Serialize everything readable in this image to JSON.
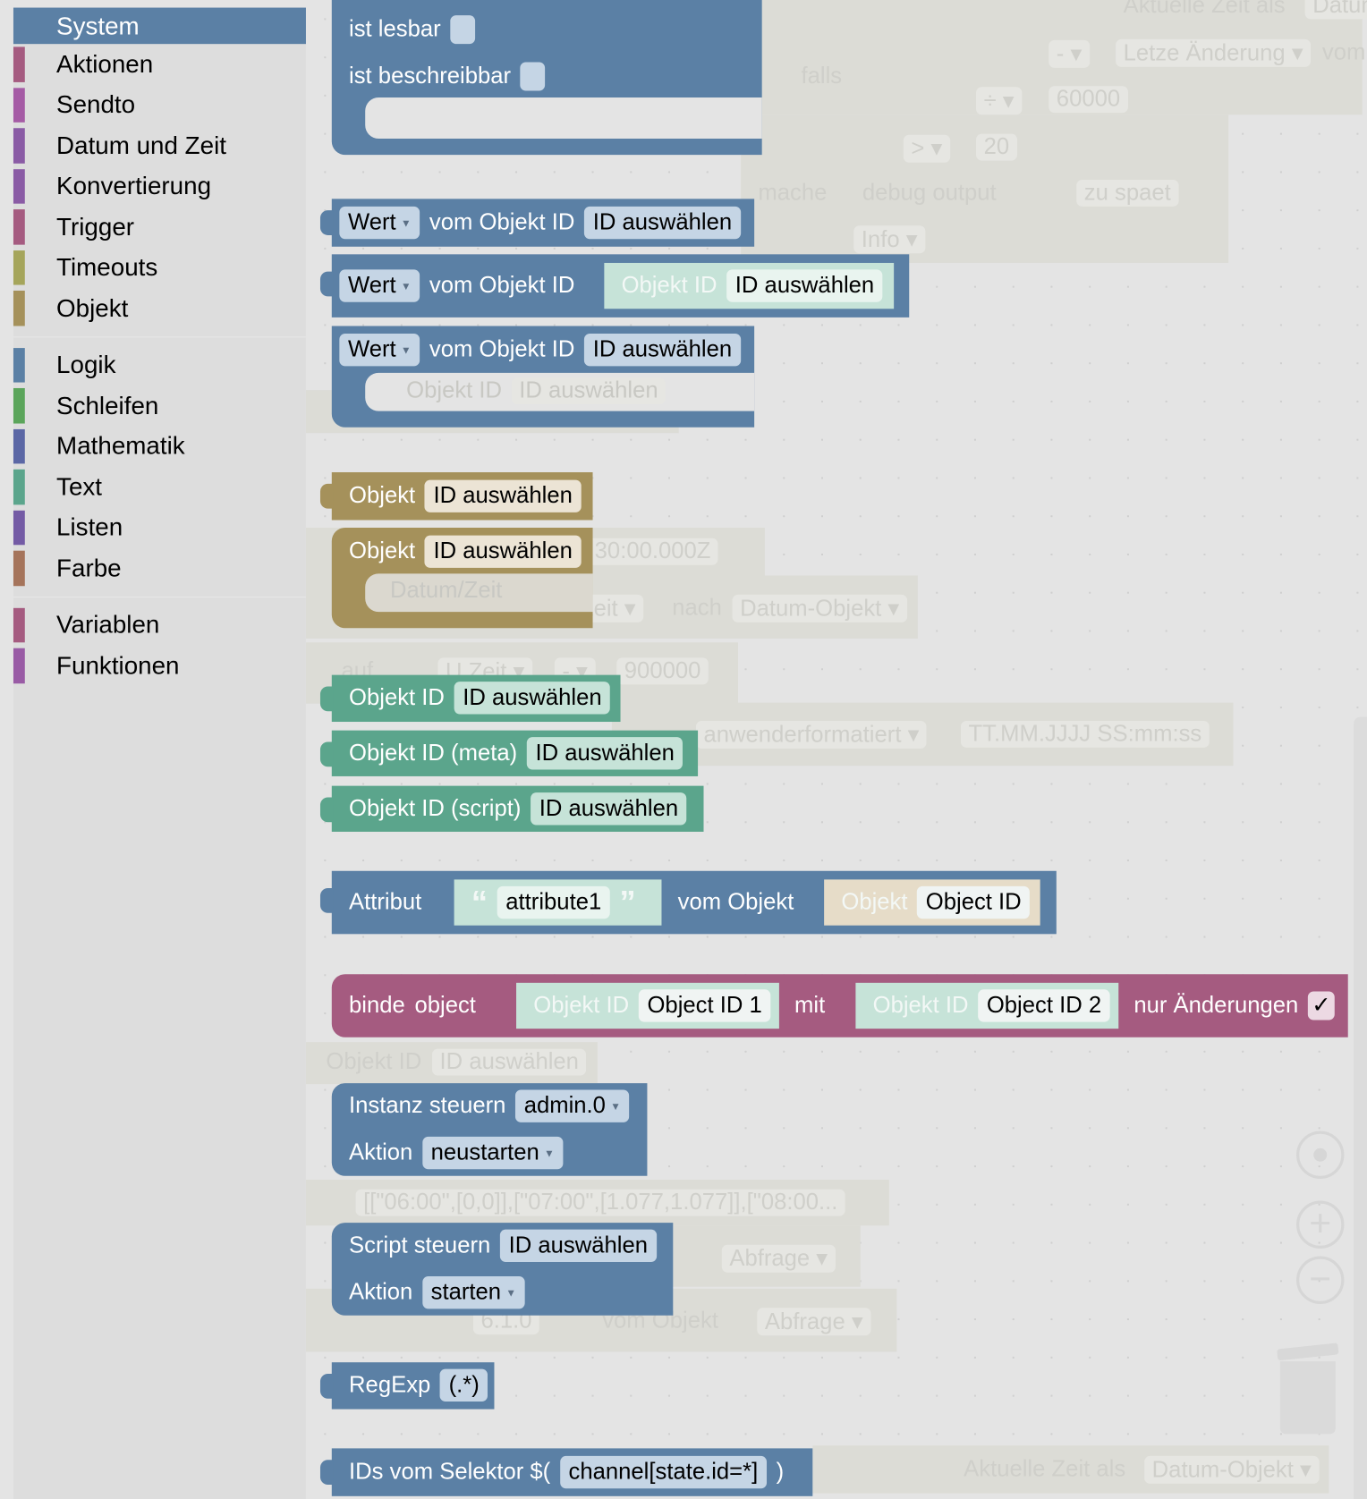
{
  "sidebar": {
    "items": [
      {
        "label": "System",
        "color": "#5b80a5",
        "selected": true
      },
      {
        "label": "Aktionen",
        "color": "#a55b80"
      },
      {
        "label": "Sendto",
        "color": "#a55ba5"
      },
      {
        "label": "Datum und Zeit",
        "color": "#8a5ba5"
      },
      {
        "label": "Konvertierung",
        "color": "#8a5ba5"
      },
      {
        "label": "Trigger",
        "color": "#a55b80"
      },
      {
        "label": "Timeouts",
        "color": "#a5a55b"
      },
      {
        "label": "Objekt",
        "color": "#a5915b"
      },
      {
        "label": "Logik",
        "color": "#5b80a5"
      },
      {
        "label": "Schleifen",
        "color": "#5ba55b"
      },
      {
        "label": "Mathematik",
        "color": "#5b67a5"
      },
      {
        "label": "Text",
        "color": "#5ba58c"
      },
      {
        "label": "Listen",
        "color": "#745ba5"
      },
      {
        "label": "Farbe",
        "color": "#a5745b"
      },
      {
        "label": "Variablen",
        "color": "#a55b80"
      },
      {
        "label": "Funktionen",
        "color": "#995ba5"
      }
    ]
  },
  "blocks": {
    "exists": {
      "readable": "ist lesbar",
      "writable": "ist beschreibbar"
    },
    "wert1": {
      "prop": "Wert",
      "label": "vom Objekt ID",
      "field": "ID auswählen"
    },
    "wert2": {
      "prop": "Wert",
      "label": "vom Objekt ID",
      "inner_label": "Objekt ID",
      "field": "ID auswählen"
    },
    "wert3": {
      "prop": "Wert",
      "label": "vom Objekt ID",
      "field": "ID auswählen"
    },
    "objekt1": {
      "label": "Objekt",
      "field": "ID auswählen"
    },
    "objekt2": {
      "label": "Objekt",
      "field": "ID auswählen"
    },
    "objid": {
      "label": "Objekt ID",
      "field": "ID auswählen"
    },
    "objid_meta": {
      "label": "Objekt ID (meta)",
      "field": "ID auswählen"
    },
    "objid_script": {
      "label": "Objekt ID (script)",
      "field": "ID auswählen"
    },
    "attribut": {
      "label": "Attribut",
      "open_quote": "“",
      "text": "attribute1",
      "close_quote": "”",
      "of_label": "vom Objekt",
      "obj_label": "Objekt",
      "obj_field": "Object ID"
    },
    "binde": {
      "label1": "binde",
      "label2": "object",
      "inner1_label": "Objekt ID",
      "inner1_field": "Object ID 1",
      "with": "mit",
      "inner2_label": "Objekt ID",
      "inner2_field": "Object ID 2",
      "only_changes": "nur Änderungen",
      "check": "✓",
      "checked": true
    },
    "instanz": {
      "label": "Instanz steuern",
      "instance": "admin.0",
      "action_label": "Aktion",
      "action": "neustarten"
    },
    "script": {
      "label": "Script steuern",
      "field": "ID auswählen",
      "action_label": "Aktion",
      "action": "starten"
    },
    "regexp": {
      "label": "RegExp",
      "field": "(.*)"
    },
    "selector": {
      "label": "IDs vom Selektor $(",
      "field": "channel[state.id=*]",
      "close": ")"
    }
  },
  "ghost": {
    "t1": "Aktuelle Zeit als",
    "t2": "Datum",
    "t3": "- ▾",
    "t4": "Letze Änderung ▾",
    "t5": "vom",
    "t6": "falls",
    "t7": "÷ ▾",
    "t8": "60000",
    "t9": "> ▾",
    "t10": "20",
    "t11": "mache",
    "t12": "debug output",
    "t13": "zu spaet",
    "t14": "Info ▾",
    "t15": "Objekt ID",
    "t16": "ID auswählen",
    "t17": "30:00.000Z",
    "t18": "Datum/Zeit",
    "t19": "O Zeit ▾",
    "t20": "nach",
    "t21": "Datum-Objekt ▾",
    "t22": "auf",
    "t23": "U Zeit ▾",
    "t24": "- ▾",
    "t25": "900000",
    "t26": "anwenderformatiert ▾",
    "t27": "TT.MM.JJJJ SS:mm:ss",
    "t28": "Objekt ID",
    "t29": "ID auswählen",
    "t30": "[[\"06:00\",[0,0]],[\"07:00\",[1.077,1.077]],[\"08:00...",
    "t31": "Abfrage ▾",
    "t32": "6.1.0",
    "t33": "vom Objekt",
    "t34": "Abfrage ▾",
    "t35": "Aktuelle Zeit als",
    "t36": "Datum-Objekt ▾"
  },
  "workspace": {
    "icons": [
      "center-icon",
      "zoom-in-icon",
      "zoom-out-icon",
      "trash-icon"
    ]
  }
}
